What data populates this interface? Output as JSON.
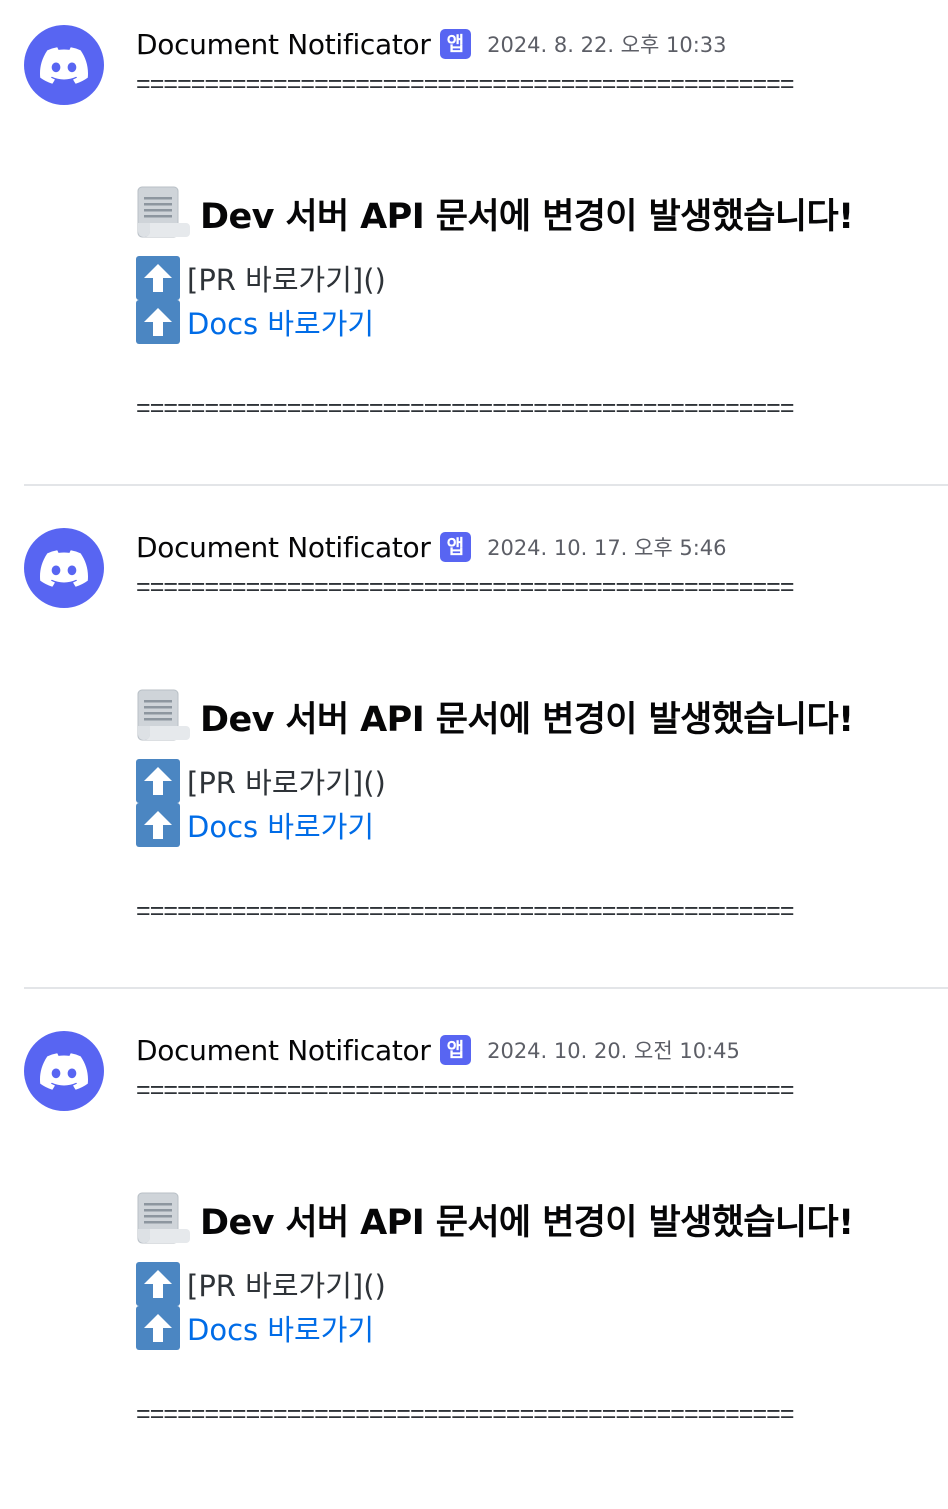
{
  "colors": {
    "accent": "#5865f2",
    "link": "#006ce7",
    "up_icon": "#4b86c2",
    "separator": "#e3e5e8"
  },
  "icons": {
    "avatar": "discord-logo-icon",
    "heading": "page-facing-up-scroll-icon",
    "links": "up-arrow-button-icon"
  },
  "messages": [
    {
      "author": "Document Notificator",
      "badge": "앱",
      "timestamp": "2024. 8. 22. 오후 10:33",
      "divider": "================================================",
      "heading": "Dev 서버 API 문서에 변경이 발생했습니다!",
      "pr_link_text": "[PR 바로가기]()",
      "docs_link_text": "Docs 바로가기"
    },
    {
      "author": "Document Notificator",
      "badge": "앱",
      "timestamp": "2024. 10. 17. 오후 5:46",
      "divider": "================================================",
      "heading": "Dev 서버 API 문서에 변경이 발생했습니다!",
      "pr_link_text": "[PR 바로가기]()",
      "docs_link_text": "Docs 바로가기"
    },
    {
      "author": "Document Notificator",
      "badge": "앱",
      "timestamp": "2024. 10. 20. 오전 10:45",
      "divider": "================================================",
      "heading": "Dev 서버 API 문서에 변경이 발생했습니다!",
      "pr_link_text": "[PR 바로가기]()",
      "docs_link_text": "Docs 바로가기"
    }
  ]
}
